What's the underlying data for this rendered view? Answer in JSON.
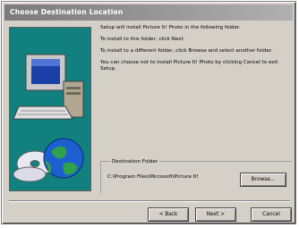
{
  "window": {
    "title": "Choose Destination Location"
  },
  "body": {
    "paragraph_1": "Setup will install Picture It! Photo in the following folder.",
    "paragraph_2": "To install to this folder, click Next.",
    "paragraph_3": "To install to a different folder, click Browse and select another folder.",
    "paragraph_4": "You can choose not to install Picture It! Photo by clicking Cancel to exit Setup."
  },
  "destination": {
    "group_label": "Destination Folder",
    "path": "C:\\Program Files\\Microsoft\\Picture It!",
    "browse_label": "Browse..."
  },
  "buttons": {
    "back_label": "< Back",
    "next_label": "Next >",
    "cancel_label": "Cancel"
  },
  "colors": {
    "dialog_face": "#d4d0c8",
    "art_panel_teal": "#11807f",
    "title_bar": "#7a7a7a"
  },
  "icons": [
    "computer-icon",
    "globe-icon",
    "cd-icon"
  ]
}
